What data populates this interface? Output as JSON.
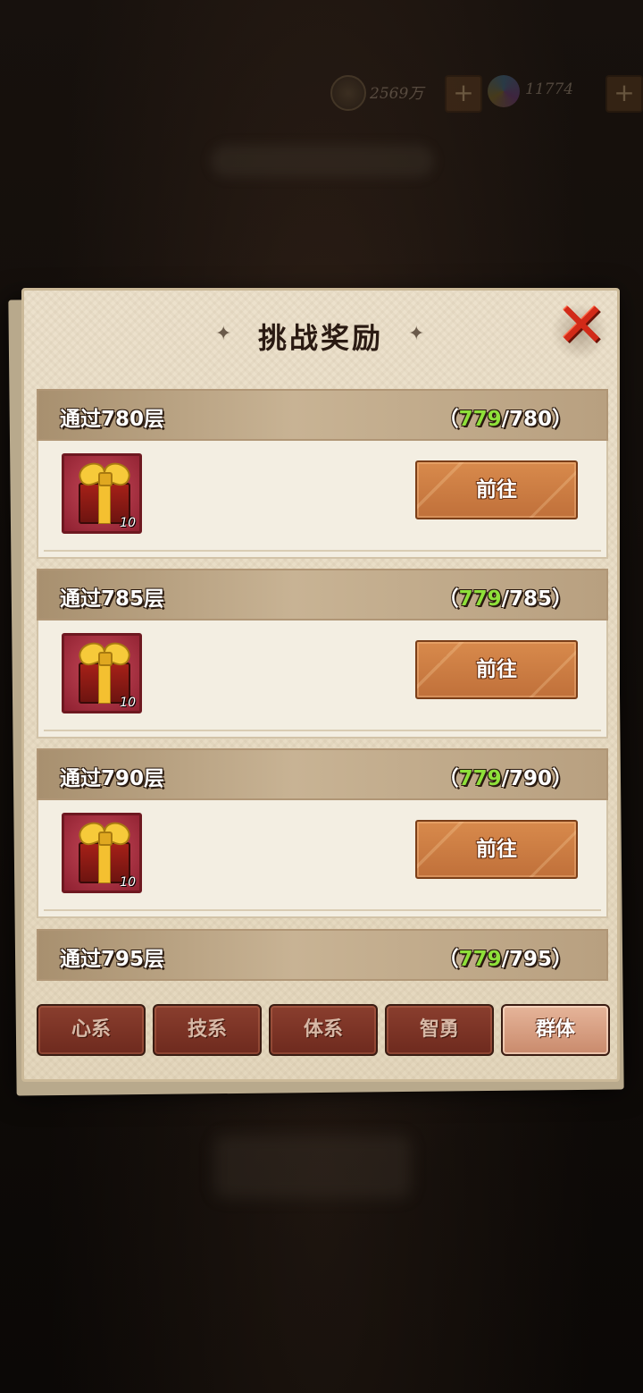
{
  "currency": {
    "coins": "2569万",
    "gems": "11774",
    "plus_glyph": "+"
  },
  "dialog": {
    "title": "挑战奖励",
    "close_glyph": "✕",
    "shuriken_glyph": "✦"
  },
  "entries": [
    {
      "title": "通过780层",
      "current": "779",
      "target": "/780",
      "reward_count": "10",
      "button": "前往"
    },
    {
      "title": "通过785层",
      "current": "779",
      "target": "/785",
      "reward_count": "10",
      "button": "前往"
    },
    {
      "title": "通过790层",
      "current": "779",
      "target": "/790",
      "reward_count": "10",
      "button": "前往"
    },
    {
      "title": "通过795层",
      "current": "779",
      "target": "/795"
    }
  ],
  "progress_brackets": {
    "open": "（",
    "close": "）"
  },
  "tabs": [
    {
      "label": "心系",
      "active": false
    },
    {
      "label": "技系",
      "active": false
    },
    {
      "label": "体系",
      "active": false
    },
    {
      "label": "智勇",
      "active": false
    },
    {
      "label": "群体",
      "active": true
    }
  ],
  "colors": {
    "progress_current": "#8ee03a",
    "close_x": "#d22a18",
    "go_button": "#c87a40",
    "tab_active": "#d9a084",
    "tab_inactive": "#7a3426"
  }
}
